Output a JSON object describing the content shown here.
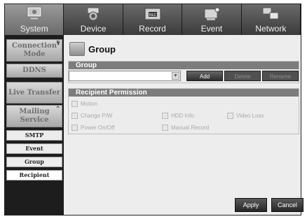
{
  "tabs": [
    {
      "label": "System",
      "icon": "system-monitor-icon",
      "active": true
    },
    {
      "label": "Device",
      "icon": "camera-icon",
      "active": false
    },
    {
      "label": "Record",
      "icon": "rec-icon",
      "active": false
    },
    {
      "label": "Event",
      "icon": "event-icon",
      "active": false
    },
    {
      "label": "Network",
      "icon": "network-icon",
      "active": false
    }
  ],
  "sidebar": {
    "connection_mode": "Connection Mode",
    "ddns": "DDNS",
    "live_transfer": "Live Transfer",
    "mailing_service": "Mailing Service",
    "sub": {
      "smtp": "SMTP",
      "event": "Event",
      "group": "Group",
      "recipient": "Recipient"
    },
    "selected": "Recipient"
  },
  "page": {
    "title": "Group",
    "title_icon": "group-icon"
  },
  "group_box": {
    "header": "Group",
    "selected_value": "",
    "add": "Add",
    "delete": "Delete",
    "rename": "Rename"
  },
  "permission_box": {
    "header": "Recipient Permission",
    "options": {
      "motion": "Motion",
      "change_pw": "Change P/W",
      "hdd_info": "HDD Info",
      "video_loss": "Video Loss",
      "power_onoff": "Power On/Off",
      "manual_record": "Manual Record"
    }
  },
  "buttons": {
    "apply": "Apply",
    "cancel": "Cancel"
  },
  "colors": {
    "header_bar": "#7c7c7c",
    "sidebar_bg": "#1d1d1d",
    "content_bg": "#ededed"
  }
}
